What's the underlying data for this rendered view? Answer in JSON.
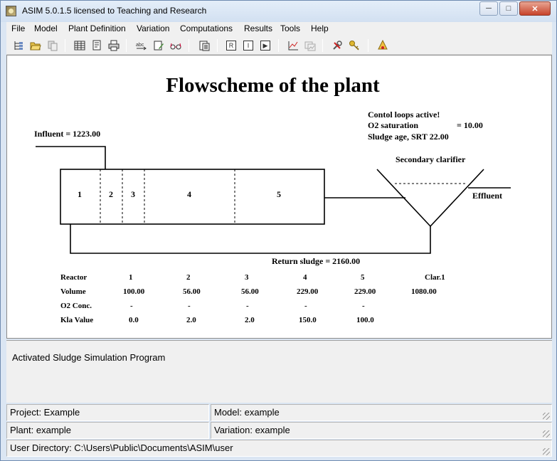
{
  "window": {
    "title": "ASIM 5.0.1.5 licensed to Teaching and Research",
    "min_glyph": "─",
    "max_glyph": "□",
    "close_glyph": "✕"
  },
  "menu": [
    "File",
    "Model",
    "Plant Definition",
    "Variation",
    "Computations",
    "Results",
    "Tools",
    "Help"
  ],
  "toolbar": {
    "buttons": [
      "tree-icon",
      "open-folder-icon",
      "copy-icon",
      "table-icon",
      "report-icon",
      "print-icon",
      "abc-icon",
      "edit-icon",
      "glasses-icon",
      "calculate-icon",
      "run-r-icon",
      "run-i-icon",
      "play-icon",
      "chart-icon",
      "chart-compare-icon",
      "tools-icon",
      "key-icon",
      "help-icon"
    ],
    "run_r_label": "R",
    "run_i_label": "I",
    "play_label": "▶"
  },
  "flowscheme": {
    "title": "Flowscheme of the plant",
    "control_loops": "Contol loops active!",
    "o2_saturation_label": "O2 saturation",
    "o2_saturation_value": "= 10.00",
    "sludge_age": "Sludge age, SRT  22.00",
    "influent": "Influent  =  1223.00",
    "secondary_clarifier": "Secondary clarifier",
    "effluent": "Effluent",
    "return_sludge": "Return sludge =  2160.00",
    "reactor_numbers": [
      "1",
      "2",
      "3",
      "4",
      "5"
    ]
  },
  "table": {
    "header_label": "Reactor",
    "columns": [
      "1",
      "2",
      "3",
      "4",
      "5",
      "Clar.1"
    ],
    "rows": [
      {
        "label": "Volume",
        "values": [
          "100.00",
          "56.00",
          "56.00",
          "229.00",
          "229.00",
          "1080.00"
        ]
      },
      {
        "label": "O2 Conc.",
        "values": [
          "-",
          "-",
          "-",
          "-",
          "-",
          ""
        ]
      },
      {
        "label": "Kla Value",
        "values": [
          "0.0",
          "2.0",
          "2.0",
          "150.0",
          "100.0",
          ""
        ]
      }
    ]
  },
  "description": "Activated Sludge Simulation Program",
  "status": {
    "project": "Project: Example",
    "model": "Model:     example",
    "plant": "Plant:     example",
    "variation": "Variation: example",
    "user_directory": "User Directory: C:\\Users\\Public\\Documents\\ASIM\\user"
  }
}
